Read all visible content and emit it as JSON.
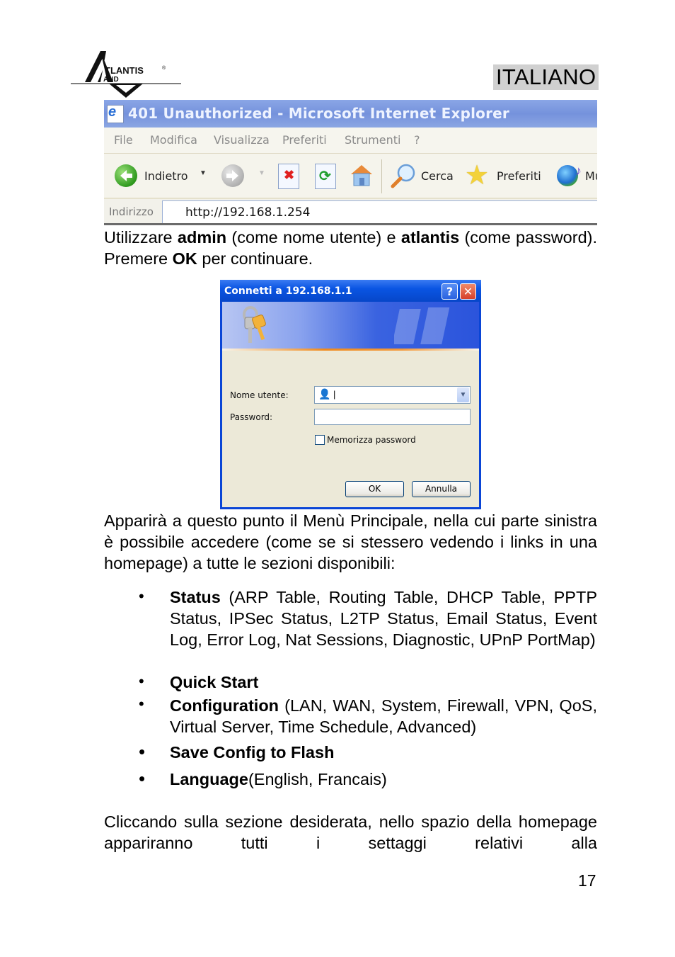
{
  "header": {
    "logo_text_top": "TLANTIS",
    "logo_text_bottom": "AND",
    "logo_initial": "A",
    "registered_mark": "®",
    "language_tag": "ITALIANO"
  },
  "browser_screenshot": {
    "title": "401 Unauthorized - Microsoft Internet Explorer",
    "menu": [
      "File",
      "Modifica",
      "Visualizza",
      "Preferiti",
      "Strumenti",
      "?"
    ],
    "toolbar": {
      "back_label": "Indietro",
      "search_label": "Cerca",
      "favorites_label": "Preferiti",
      "media_label_partial": "Mu"
    },
    "address_label": "Indirizzo",
    "address_value": "http://192.168.1.254"
  },
  "paragraph1": {
    "t1": "Utilizzare ",
    "b1": "admin",
    "t2": " (come nome utente) e ",
    "b2": "atlantis",
    "t3": " (come password). Premere ",
    "b3": "OK",
    "t4": " per continuare."
  },
  "login_dialog": {
    "title": "Connetti a 192.168.1.1",
    "help_button": "?",
    "close_button": "✕",
    "username_label": "Nome utente:",
    "username_value": "|",
    "password_label": "Password:",
    "password_value": "",
    "remember_label": "Memorizza password",
    "remember_checked": false,
    "ok_label": "OK",
    "cancel_label": "Annulla"
  },
  "paragraph2": "Apparirà a questo punto il Menù Principale, nella cui parte sinistra è possibile accedere (come se si stessero vedendo i links in una homepage) a tutte le sezioni disponibili:",
  "sections": [
    {
      "bold": "Status",
      "rest": " (ARP Table, Routing Table, DHCP Table, PPTP Status, IPSec Status, L2TP Status, Email Status, Event Log, Error Log,  Nat Sessions, Diagnostic, UPnP PortMap)"
    },
    {
      "bold": "Quick Start",
      "rest": ""
    },
    {
      "bold": "Configuration",
      "rest": " (LAN, WAN, System, Firewall, VPN, QoS,  Virtual Server, Time Schedule, Advanced)"
    },
    {
      "bold": "Save Config to Flash",
      "rest": ""
    },
    {
      "bold": "Language",
      "rest": "(English, Francais)"
    }
  ],
  "bullet_glyph": "•",
  "paragraph3": "Cliccando sulla sezione desiderata, nello spazio della homepage appariranno tutti i settaggi relativi alla",
  "page_number": "17"
}
